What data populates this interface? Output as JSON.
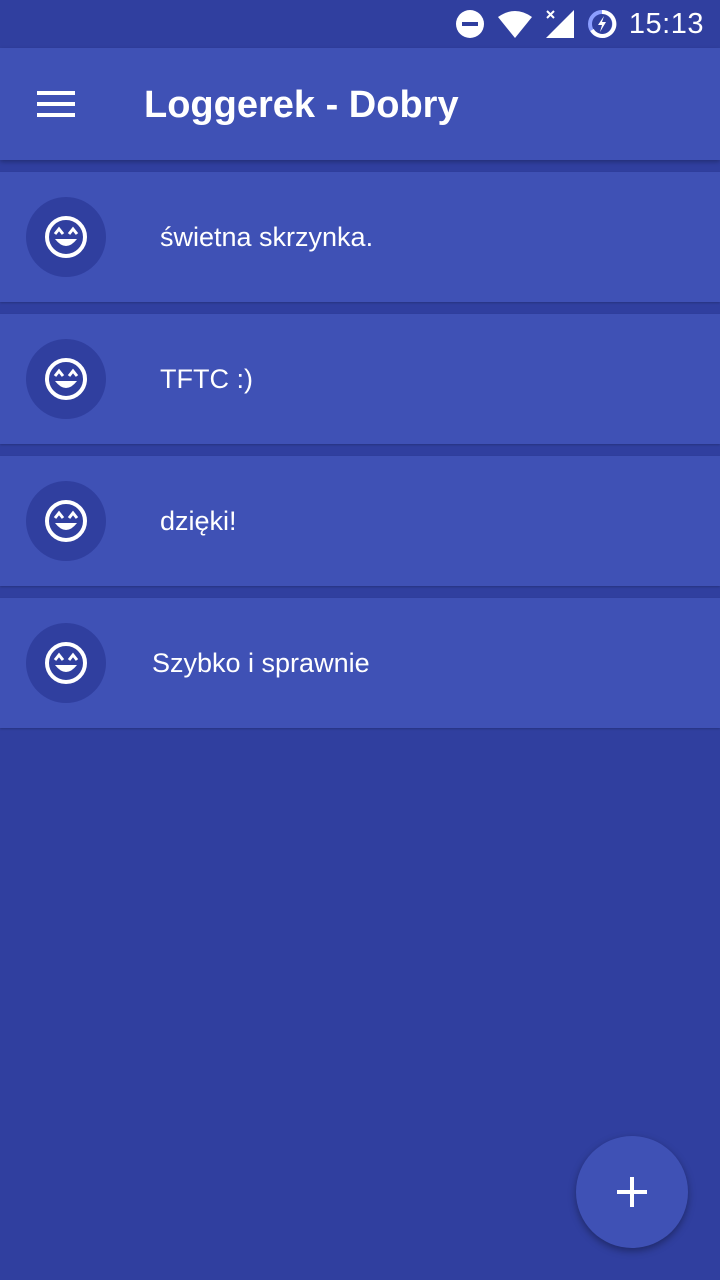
{
  "status_bar": {
    "time": "15:13",
    "icons": [
      "do-not-disturb-icon",
      "wifi-icon",
      "signal-no-data-icon",
      "battery-charging-icon"
    ]
  },
  "app_bar": {
    "menu_icon": "hamburger-menu-icon",
    "title": "Loggerek - Dobry"
  },
  "logs": [
    {
      "text": "świetna skrzynka.",
      "icon": "smiley-grin-icon"
    },
    {
      "text": "TFTC :)",
      "icon": "smiley-grin-icon"
    },
    {
      "text": "dzięki!",
      "icon": "smiley-grin-icon"
    },
    {
      "text": "Szybko i sprawnie",
      "icon": "smiley-grin-icon"
    }
  ],
  "fab": {
    "icon": "plus-icon"
  },
  "colors": {
    "primary": "#3F51B5",
    "primary_dark": "#303F9F",
    "text": "#FFFFFF"
  }
}
